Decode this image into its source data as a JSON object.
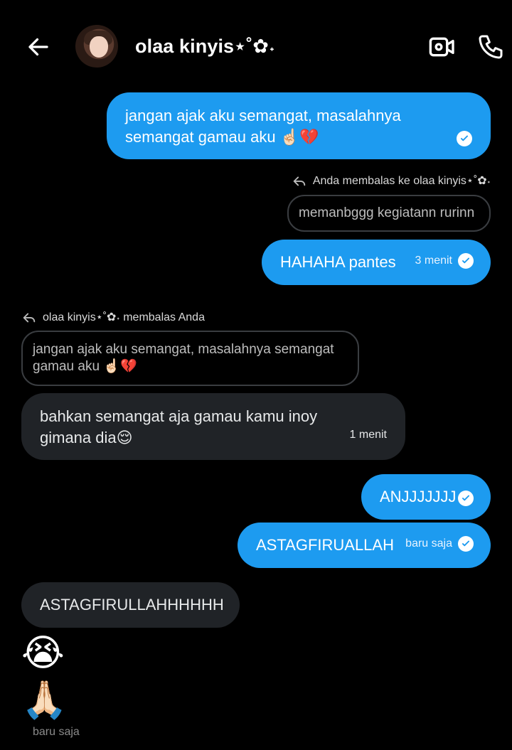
{
  "header": {
    "title": "olaa kinyis⋆˚✿˖",
    "back_icon": "arrow-left-icon",
    "video_icon": "video-camera-icon",
    "phone_icon": "phone-icon"
  },
  "messages": {
    "m1": {
      "text": "jangan ajak aku semangat, masalahnya semangat gamau aku ☝🏻💔"
    },
    "reply1": {
      "label": "Anda membalas ke olaa kinyis⋆˚✿˖",
      "quote": "memanbggg kegiatann rurinn"
    },
    "m2": {
      "text": "HAHAHA pantes",
      "time": "3 menit"
    },
    "reply2": {
      "label": "olaa kinyis⋆˚✿˖ membalas Anda",
      "quote": "jangan ajak aku semangat, masalahnya semangat gamau aku ☝🏻💔"
    },
    "m3": {
      "text": "bahkan semangat aja gamau kamu inoy gimana dia😌",
      "time": "1 menit"
    },
    "m4": {
      "text": "ANJJJJJJJ"
    },
    "m5": {
      "text": "ASTAGFIRUALLAH",
      "time": "baru saja"
    },
    "m6": {
      "text": "ASTAGFIRULLAHHHHHH"
    },
    "m7": {
      "text": "😭"
    },
    "m8": {
      "text": "🙏🏻"
    },
    "last_time": "baru saja"
  },
  "colors": {
    "outgoing_bubble": "#1D9BF0",
    "incoming_bubble": "#202327",
    "background": "#000000"
  }
}
